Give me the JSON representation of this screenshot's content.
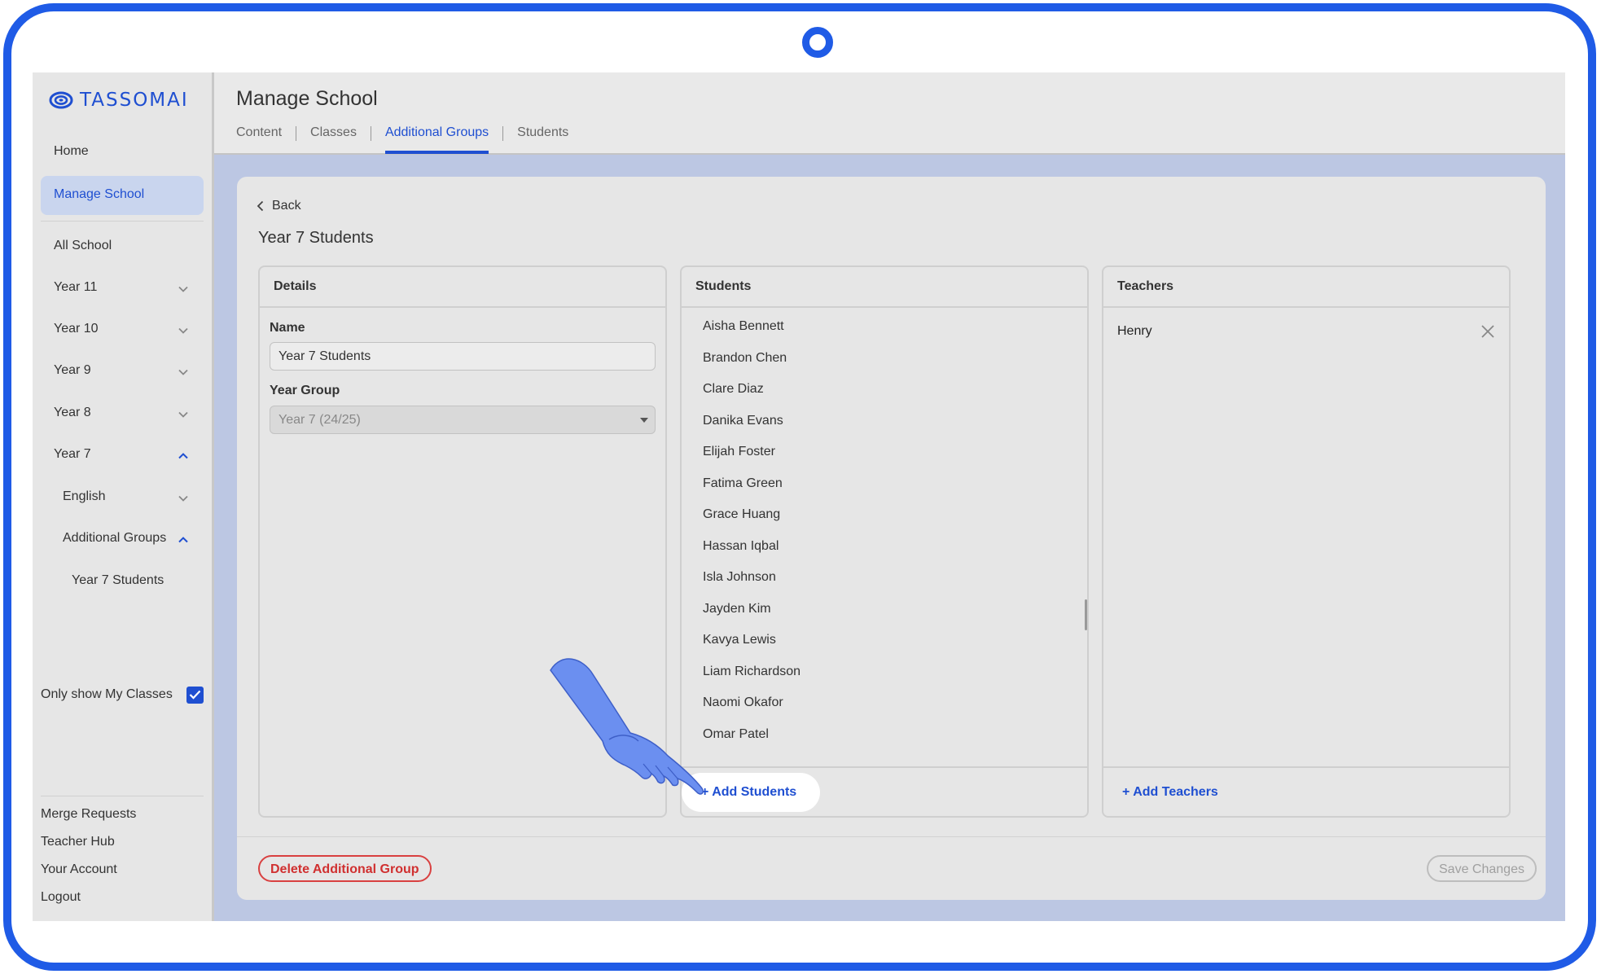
{
  "app": {
    "brand": "TASSOMAI"
  },
  "sidebar": {
    "home": "Home",
    "manage_school": "Manage School",
    "all_school": "All School",
    "years": [
      "Year 11",
      "Year 10",
      "Year 9",
      "Year 8",
      "Year 7"
    ],
    "year7_children": {
      "english": "English",
      "additional_groups": "Additional Groups",
      "year7_students": "Year 7 Students"
    },
    "only_my_classes": {
      "label": "Only show My Classes",
      "checked": true
    },
    "links": [
      "Merge Requests",
      "Teacher Hub",
      "Your Account",
      "Logout"
    ]
  },
  "header": {
    "title": "Manage School",
    "tabs": [
      {
        "label": "Content"
      },
      {
        "label": "Classes"
      },
      {
        "label": "Additional Groups",
        "active": true
      },
      {
        "label": "Students"
      }
    ]
  },
  "group": {
    "back": "Back",
    "title": "Year 7 Students",
    "details": {
      "heading": "Details",
      "name_label": "Name",
      "name_value": "Year 7 Students",
      "year_group_label": "Year Group",
      "year_group_value": "Year 7 (24/25)"
    },
    "students": {
      "heading": "Students",
      "list": [
        "Aisha Bennett",
        "Brandon Chen",
        "Clare Diaz",
        "Danika Evans",
        "Elijah Foster",
        "Fatima Green",
        "Grace Huang",
        "Hassan Iqbal",
        "Isla Johnson",
        "Jayden Kim",
        "Kavya Lewis",
        "Liam Richardson",
        "Naomi Okafor",
        "Omar Patel"
      ],
      "add": "+ Add Students"
    },
    "teachers": {
      "heading": "Teachers",
      "list": [
        "Henry"
      ],
      "add": "+ Add Teachers"
    },
    "delete": "Delete Additional Group",
    "save": "Save Changes"
  },
  "colors": {
    "accent": "#1f4fd1",
    "frame": "#1f5be6",
    "danger": "#d03030",
    "content_band": "#bcc7e3"
  }
}
